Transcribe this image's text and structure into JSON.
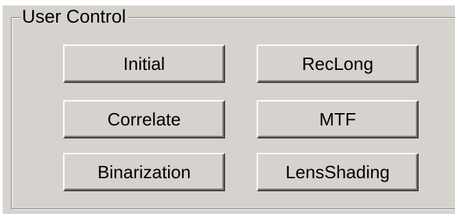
{
  "groupbox": {
    "title": "User Control"
  },
  "buttons": {
    "initial": "Initial",
    "reclong": "RecLong",
    "correlate": "Correlate",
    "mtf": "MTF",
    "binarization": "Binarization",
    "lensshading": "LensShading"
  },
  "colors": {
    "dialog_background": "#d6d3ce",
    "highlight": "#ffffff",
    "shadow": "#808080",
    "dark_shadow": "#404040",
    "text": "#000000"
  }
}
